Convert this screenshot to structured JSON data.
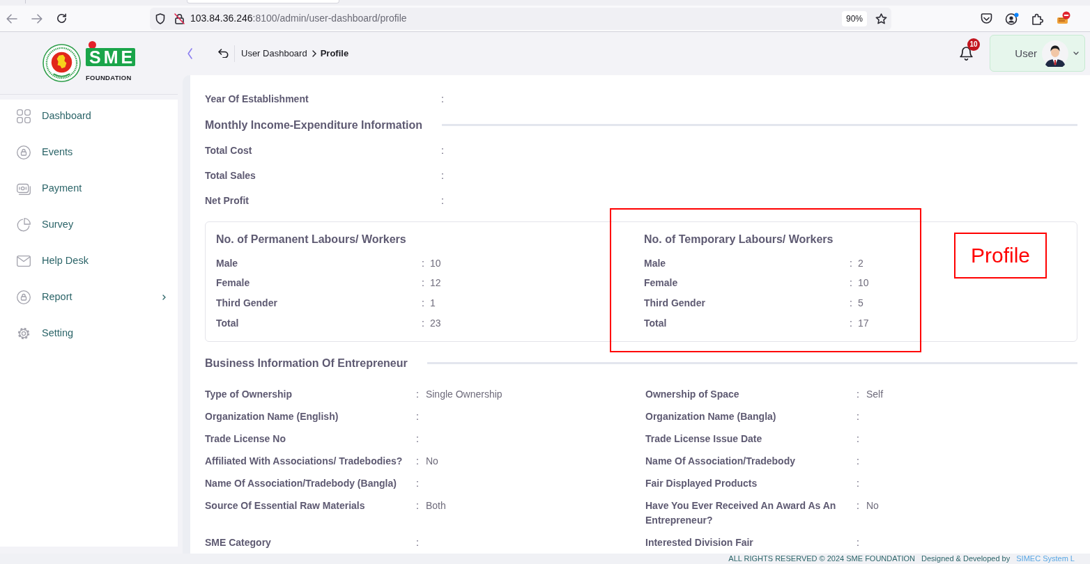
{
  "browser": {
    "url_host": "103.84.36.246",
    "url_path": ":8100/admin/user-dashboard/profile",
    "zoom": "90%"
  },
  "header": {
    "logo": {
      "wordmark": "SME",
      "tagline": "FOUNDATION"
    },
    "breadcrumb": [
      {
        "label": "User Dashboard",
        "current": false
      },
      {
        "label": "Profile",
        "current": true
      }
    ],
    "notification_count": "10",
    "user": "User"
  },
  "sidebar": {
    "items": [
      {
        "label": "Dashboard",
        "submenu": false
      },
      {
        "label": "Events",
        "submenu": false
      },
      {
        "label": "Payment",
        "submenu": false
      },
      {
        "label": "Survey",
        "submenu": false
      },
      {
        "label": "Help Desk",
        "submenu": false
      },
      {
        "label": "Report",
        "submenu": true
      },
      {
        "label": "Setting",
        "submenu": false
      }
    ]
  },
  "additional_information": {
    "fields": [
      {
        "label": "Year Of Establishment",
        "separator": ":"
      }
    ]
  },
  "monthly_income_expenditure": {
    "title": "Monthly Income-Expenditure Information",
    "fields": [
      {
        "label": "Total Cost",
        "separator": ":"
      },
      {
        "label": "Total Sales",
        "separator": ":"
      },
      {
        "label": "Net Profit",
        "separator": ":"
      }
    ]
  },
  "labour_counts": [
    {
      "title": "No. of Permanent Labours/ Workers",
      "rows": [
        {
          "label": "Male",
          "separator": ":",
          "value": "10"
        },
        {
          "label": "Female",
          "separator": ":",
          "value": "12"
        },
        {
          "label": "Third Gender",
          "separator": ":",
          "value": "1"
        },
        {
          "label": "Total",
          "separator": ":",
          "value": "23"
        }
      ]
    },
    {
      "title": "No. of Temporary Labours/ Workers",
      "rows": [
        {
          "label": "Male",
          "separator": ":",
          "value": "2"
        },
        {
          "label": "Female",
          "separator": ":",
          "value": "10"
        },
        {
          "label": "Third Gender",
          "separator": ":",
          "value": "5"
        },
        {
          "label": "Total",
          "separator": ":",
          "value": "17"
        }
      ]
    }
  ],
  "business_information": {
    "title": "Business Information Of Entrepreneur",
    "fields": [
      {
        "label": "Type of Ownership",
        "separator": ":",
        "value": "Single Ownership"
      },
      {
        "label": "Ownership of Space",
        "separator": ":",
        "value": "Self"
      },
      {
        "label": "Organization Name (English)",
        "separator": ":"
      },
      {
        "label": "Organization Name (Bangla)",
        "separator": ":"
      },
      {
        "label": "Trade License No",
        "separator": ":"
      },
      {
        "label": "Trade License Issue Date",
        "separator": ":"
      },
      {
        "label": "Affiliated With Associations/ Tradebodies?",
        "separator": ":",
        "value": "No"
      },
      {
        "label": "Name Of Association/Tradebody",
        "separator": ":"
      },
      {
        "label": "Name Of Association/Tradebody (Bangla)",
        "separator": ":"
      },
      {
        "label": "Fair Displayed Products",
        "separator": ":"
      },
      {
        "label": "Source Of Essential Raw Materials",
        "separator": ":",
        "value": "Both"
      },
      {
        "label": "Have You Ever Received An Award As An Entrepreneur?",
        "separator": ":",
        "value": "No"
      },
      {
        "label": "SME Category",
        "separator": ":"
      },
      {
        "label": "Interested Division Fair",
        "separator": ":"
      }
    ]
  },
  "annotations": [
    {
      "kind": "frame"
    },
    {
      "kind": "callout",
      "text": "Profile"
    }
  ],
  "footer": {
    "copyright": "ALL RIGHTS RESERVED © 2024 SME FOUNDATION",
    "credit": "Designed & Developed by",
    "developer": "SIMEC System L"
  }
}
